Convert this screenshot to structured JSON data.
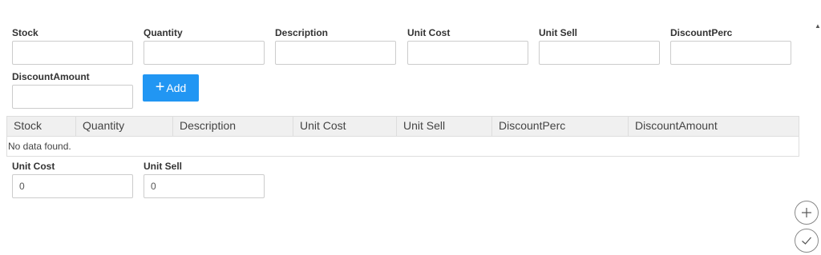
{
  "form": {
    "stock": {
      "label": "Stock",
      "value": ""
    },
    "quantity": {
      "label": "Quantity",
      "value": ""
    },
    "description": {
      "label": "Description",
      "value": ""
    },
    "unit_cost": {
      "label": "Unit Cost",
      "value": ""
    },
    "unit_sell": {
      "label": "Unit Sell",
      "value": ""
    },
    "discount_perc": {
      "label": "DiscountPerc",
      "value": ""
    },
    "discount_amount": {
      "label": "DiscountAmount",
      "value": ""
    },
    "add_button": {
      "label": "Add",
      "icon": "plus-icon"
    }
  },
  "grid": {
    "columns": [
      "Stock",
      "Quantity",
      "Description",
      "Unit Cost",
      "Unit Sell",
      "DiscountPerc",
      "DiscountAmount"
    ],
    "empty_text": "No data found."
  },
  "totals": {
    "unit_cost": {
      "label": "Unit Cost",
      "value": "0"
    },
    "unit_sell": {
      "label": "Unit Sell",
      "value": "0"
    }
  },
  "side_actions": {
    "add_icon": "plus-circle-icon",
    "confirm_icon": "check-circle-icon"
  }
}
